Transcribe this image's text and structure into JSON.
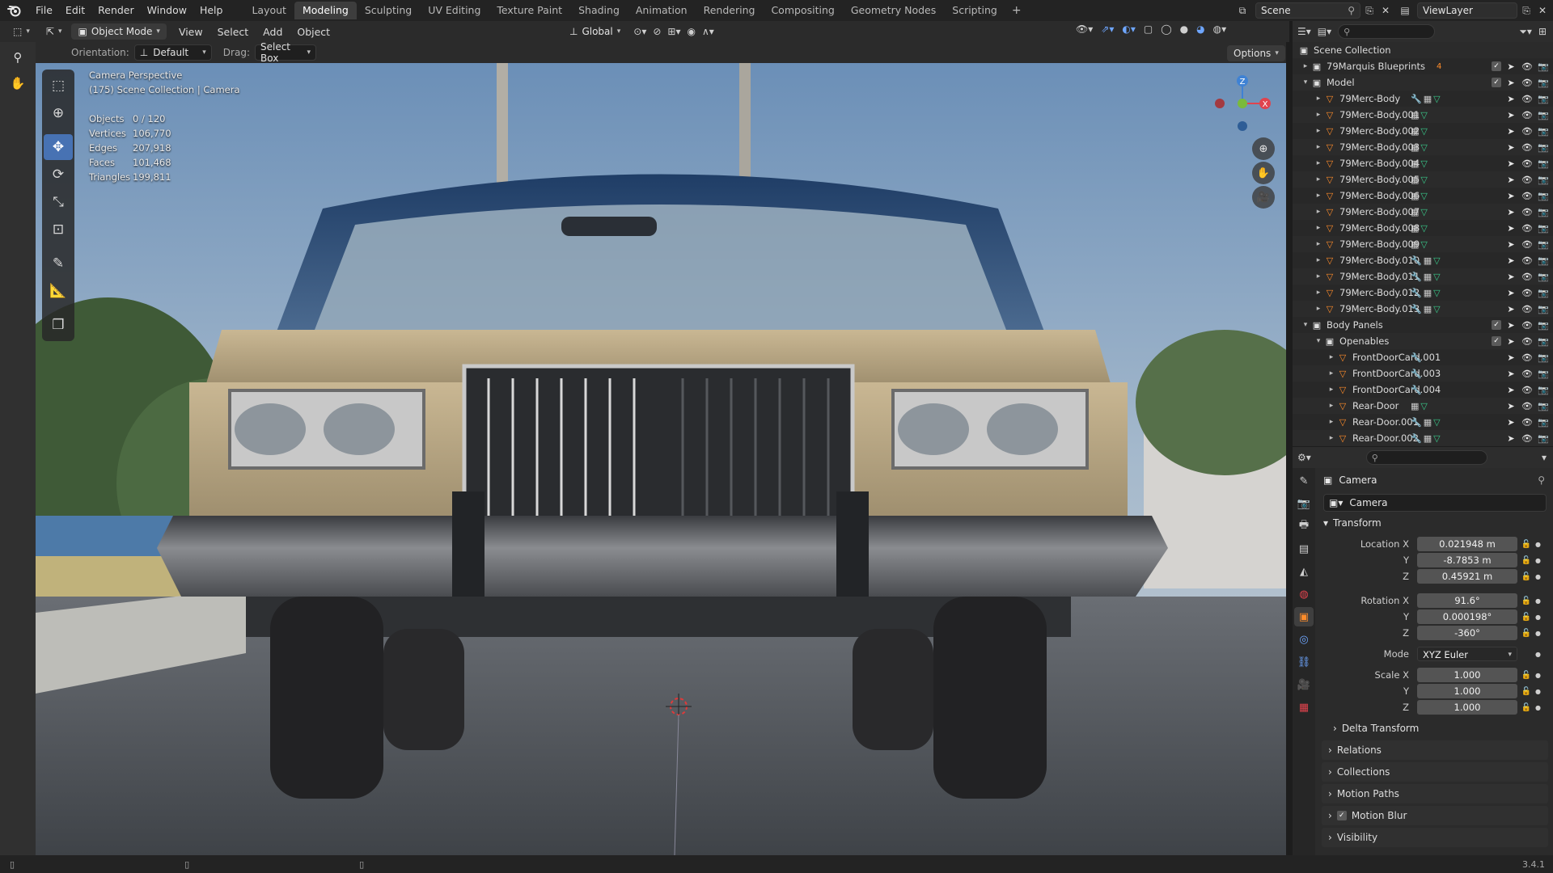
{
  "menu": [
    "File",
    "Edit",
    "Render",
    "Window",
    "Help"
  ],
  "workspaces": {
    "tabs": [
      "Layout",
      "Modeling",
      "Sculpting",
      "UV Editing",
      "Texture Paint",
      "Shading",
      "Animation",
      "Rendering",
      "Compositing",
      "Geometry Nodes",
      "Scripting"
    ],
    "active": "Modeling",
    "plus": "+"
  },
  "scene": "Scene",
  "view_layer": "ViewLayer",
  "viewport_header": {
    "mode": "Object Mode",
    "menus": [
      "View",
      "Select",
      "Add",
      "Object"
    ],
    "transform_orientation": "Global"
  },
  "tool_settings": {
    "orientation_label": "Orientation:",
    "orientation_value": "Default",
    "drag_label": "Drag:",
    "drag_value": "Select Box",
    "options": "Options"
  },
  "overlay": {
    "view_name": "Camera Perspective",
    "collection_info": "(175) Scene Collection | Camera",
    "stats": [
      {
        "label": "Objects",
        "value": "0 / 120"
      },
      {
        "label": "Vertices",
        "value": "106,770"
      },
      {
        "label": "Edges",
        "value": "207,918"
      },
      {
        "label": "Faces",
        "value": "101,468"
      },
      {
        "label": "Triangles",
        "value": "199,811"
      }
    ]
  },
  "gizmo": {
    "z": "Z",
    "x": "X"
  },
  "outliner": {
    "root": "Scene Collection",
    "rows": [
      {
        "name": "79Marquis Blueprints",
        "type": "collection",
        "expand": "▸",
        "indent": 0,
        "badge": "4"
      },
      {
        "name": "Model",
        "type": "collection",
        "expand": "▾",
        "indent": 0
      },
      {
        "name": "79Merc-Body",
        "type": "mesh",
        "expand": "▸",
        "indent": 1,
        "mods": "wmg"
      },
      {
        "name": "79Merc-Body.001",
        "type": "mesh",
        "expand": "▸",
        "indent": 1,
        "mods": "mg"
      },
      {
        "name": "79Merc-Body.002",
        "type": "mesh",
        "expand": "▸",
        "indent": 1,
        "mods": "mg"
      },
      {
        "name": "79Merc-Body.003",
        "type": "mesh",
        "expand": "▸",
        "indent": 1,
        "mods": "mg"
      },
      {
        "name": "79Merc-Body.004",
        "type": "mesh",
        "expand": "▸",
        "indent": 1,
        "mods": "mg"
      },
      {
        "name": "79Merc-Body.005",
        "type": "mesh",
        "expand": "▸",
        "indent": 1,
        "mods": "mg"
      },
      {
        "name": "79Merc-Body.006",
        "type": "mesh",
        "expand": "▸",
        "indent": 1,
        "mods": "mg"
      },
      {
        "name": "79Merc-Body.007",
        "type": "mesh",
        "expand": "▸",
        "indent": 1,
        "mods": "mg"
      },
      {
        "name": "79Merc-Body.008",
        "type": "mesh",
        "expand": "▸",
        "indent": 1,
        "mods": "mg"
      },
      {
        "name": "79Merc-Body.009",
        "type": "mesh",
        "expand": "▸",
        "indent": 1,
        "mods": "mg"
      },
      {
        "name": "79Merc-Body.010",
        "type": "mesh",
        "expand": "▸",
        "indent": 1,
        "mods": "wmg"
      },
      {
        "name": "79Merc-Body.011",
        "type": "mesh",
        "expand": "▸",
        "indent": 1,
        "mods": "wmg"
      },
      {
        "name": "79Merc-Body.012",
        "type": "mesh",
        "expand": "▸",
        "indent": 1,
        "mods": "wmg"
      },
      {
        "name": "79Merc-Body.013",
        "type": "mesh",
        "expand": "▸",
        "indent": 1,
        "mods": "wmg"
      },
      {
        "name": "Body Panels",
        "type": "collection",
        "expand": "▾",
        "indent": 0
      },
      {
        "name": "Openables",
        "type": "collection",
        "expand": "▾",
        "indent": 1
      },
      {
        "name": "FrontDoorCard.001",
        "type": "mesh",
        "expand": "▸",
        "indent": 2,
        "mods": "w"
      },
      {
        "name": "FrontDoorCard.003",
        "type": "mesh",
        "expand": "▸",
        "indent": 2,
        "mods": "w"
      },
      {
        "name": "FrontDoorCard.004",
        "type": "mesh",
        "expand": "▸",
        "indent": 2,
        "mods": "w"
      },
      {
        "name": "Rear-Door",
        "type": "mesh",
        "expand": "▸",
        "indent": 2,
        "mods": "mg"
      },
      {
        "name": "Rear-Door.001",
        "type": "mesh",
        "expand": "▸",
        "indent": 2,
        "mods": "wmg"
      },
      {
        "name": "Rear-Door.002",
        "type": "mesh",
        "expand": "▸",
        "indent": 2,
        "mods": "wmg"
      }
    ]
  },
  "properties": {
    "object_name": "Camera",
    "data_name": "Camera",
    "transform_panel": "Transform",
    "location_label": "Location X",
    "location": [
      "0.021948 m",
      "-8.7853 m",
      "0.45921 m"
    ],
    "rotation_label": "Rotation X",
    "rotation": [
      "91.6°",
      "0.000198°",
      "-360°"
    ],
    "mode_label": "Mode",
    "mode_value": "XYZ Euler",
    "scale_label": "Scale X",
    "scale": [
      "1.000",
      "1.000",
      "1.000"
    ],
    "y_label": "Y",
    "z_label": "Z",
    "delta_transform": "Delta Transform",
    "collapsed": [
      "Relations",
      "Collections",
      "Motion Paths",
      "Motion Blur",
      "Visibility"
    ]
  },
  "status": {
    "version": "3.4.1"
  },
  "colors": {
    "accent": "#4772b3",
    "mesh_icon": "#ff8c2a",
    "x_axis": "#e0434d",
    "y_axis": "#7aba3b",
    "z_axis": "#3f82d4"
  }
}
